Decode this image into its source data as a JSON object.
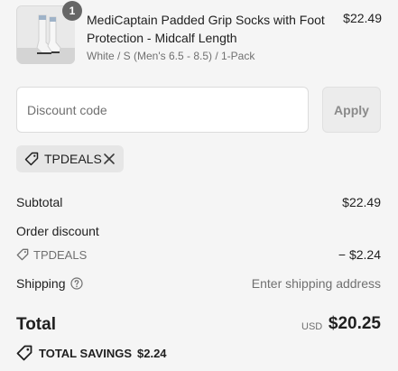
{
  "product": {
    "name": "MediCaptain Padded Grip Socks with Foot Protection - Midcalf Length",
    "variant": "White / S (Men's 6.5 - 8.5) / 1-Pack",
    "price": "$22.49",
    "quantity": "1",
    "image_icon": "product-socks-thumbnail"
  },
  "discount": {
    "placeholder": "Discount code",
    "value": "",
    "apply_label": "Apply",
    "applied_code": "TPDEALS",
    "tag_icon": "tag-icon",
    "remove_icon": "close-icon"
  },
  "summary": {
    "subtotal_label": "Subtotal",
    "subtotal_value": "$22.49",
    "order_discount_label": "Order discount",
    "discount_code": "TPDEALS",
    "discount_value": "− $2.24",
    "shipping_label": "Shipping",
    "shipping_value": "Enter shipping address",
    "help_icon": "question-circle-icon",
    "total_label": "Total",
    "currency": "USD",
    "total_value": "$20.25",
    "savings_label": "TOTAL SAVINGS",
    "savings_value": "$2.24"
  },
  "colors": {
    "background": "#f5f5f5",
    "text": "#1f1f1f",
    "muted_text": "#707070",
    "badge": "#666666",
    "chip": "#e6e6e6",
    "apply_button": "#ececec"
  }
}
